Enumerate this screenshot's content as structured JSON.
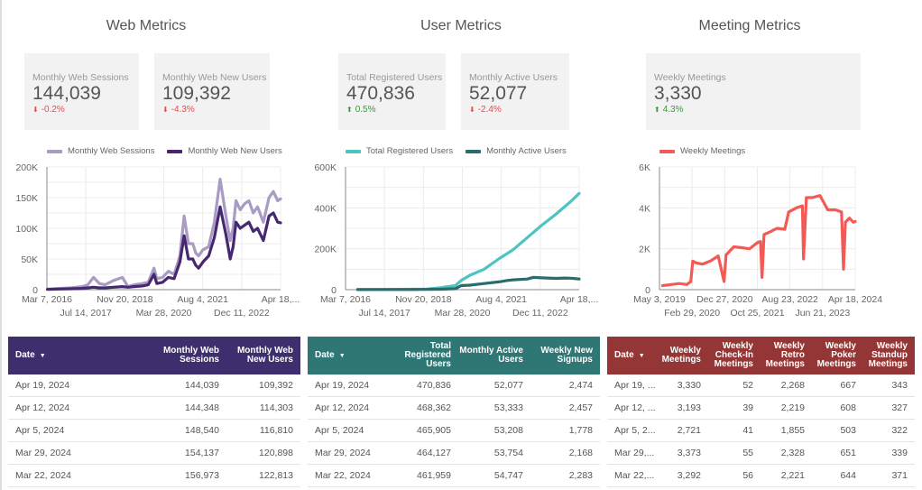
{
  "sections": {
    "web": {
      "title": "Web Metrics",
      "scorecards": [
        {
          "label": "Monthly Web Sessions",
          "value": "144,039",
          "delta": "-0.2%",
          "direction": "down"
        },
        {
          "label": "Monthly Web New Users",
          "value": "109,392",
          "delta": "-4.3%",
          "direction": "down"
        }
      ],
      "table": {
        "header_color": "#3f2e6e",
        "columns": [
          "Date",
          "Monthly Web Sessions",
          "Monthly Web New Users"
        ],
        "rows": [
          [
            "Apr 19, 2024",
            "144,039",
            "109,392"
          ],
          [
            "Apr 12, 2024",
            "144,348",
            "114,303"
          ],
          [
            "Apr 5, 2024",
            "148,540",
            "116,810"
          ],
          [
            "Mar 29, 2024",
            "154,137",
            "120,898"
          ],
          [
            "Mar 22, 2024",
            "156,973",
            "122,813"
          ]
        ]
      }
    },
    "user": {
      "title": "User Metrics",
      "scorecards": [
        {
          "label": "Total Registered Users",
          "value": "470,836",
          "delta": "0.5%",
          "direction": "up"
        },
        {
          "label": "Monthly Active Users",
          "value": "52,077",
          "delta": "-2.4%",
          "direction": "down"
        }
      ],
      "table": {
        "header_color": "#2e7775",
        "columns": [
          "Date",
          "Total Registered Users",
          "Monthly Active Users",
          "Weekly New Signups"
        ],
        "rows": [
          [
            "Apr 19, 2024",
            "470,836",
            "52,077",
            "2,474"
          ],
          [
            "Apr 12, 2024",
            "468,362",
            "53,333",
            "2,457"
          ],
          [
            "Apr 5, 2024",
            "465,905",
            "53,208",
            "1,778"
          ],
          [
            "Mar 29, 2024",
            "464,127",
            "53,754",
            "2,168"
          ],
          [
            "Mar 22, 2024",
            "461,959",
            "54,747",
            "2,283"
          ]
        ]
      }
    },
    "meeting": {
      "title": "Meeting Metrics",
      "scorecards": [
        {
          "label": "Weekly Meetings",
          "value": "3,330",
          "delta": "4.3%",
          "direction": "up"
        }
      ],
      "table": {
        "header_color": "#943635",
        "columns": [
          "Date",
          "Weekly Meetings",
          "Weekly Check-In Meetings",
          "Weekly Retro Meetings",
          "Weekly Poker Meetings",
          "Weekly Standup Meetings"
        ],
        "rows": [
          [
            "Apr 19, ...",
            "3,330",
            "52",
            "2,268",
            "667",
            "343"
          ],
          [
            "Apr 12, ...",
            "3,193",
            "39",
            "2,219",
            "608",
            "327"
          ],
          [
            "Apr 5, 2...",
            "2,721",
            "41",
            "1,855",
            "503",
            "322"
          ],
          [
            "Mar 29,...",
            "3,373",
            "55",
            "2,328",
            "651",
            "339"
          ],
          [
            "Mar 22,...",
            "3,292",
            "56",
            "2,221",
            "644",
            "371"
          ]
        ]
      }
    }
  },
  "icons": {
    "sort": "▼",
    "down": "⬇",
    "up": "⬆"
  },
  "colors": {
    "down": "#e84c4c",
    "up": "#3a9a3a"
  },
  "chart_data": [
    {
      "type": "line",
      "title": "",
      "legend": "top",
      "ylim": [
        0,
        200000
      ],
      "yticks": [
        "0",
        "50K",
        "100K",
        "150K",
        "200K"
      ],
      "xticks_row1": [
        "Mar 7, 2016",
        "Nov 20, 2018",
        "Aug 4, 2021",
        "Apr 18,..."
      ],
      "xticks_row2": [
        "Jul 14, 2017",
        "Mar 28, 2020",
        "Dec 11, 2022"
      ],
      "x_range": [
        2016.18,
        2024.3
      ],
      "series": [
        {
          "name": "Monthly Web Sessions",
          "color": "#a99bc4",
          "x": [
            2016.2,
            2016.6,
            2017.0,
            2017.4,
            2017.6,
            2017.8,
            2018.0,
            2018.2,
            2018.5,
            2018.8,
            2019.0,
            2019.2,
            2019.5,
            2019.7,
            2019.9,
            2020.0,
            2020.2,
            2020.4,
            2020.6,
            2020.8,
            2020.95,
            2021.1,
            2021.25,
            2021.35,
            2021.45,
            2021.6,
            2021.8,
            2022.0,
            2022.2,
            2022.4,
            2022.55,
            2022.65,
            2022.75,
            2022.9,
            2023.05,
            2023.2,
            2023.35,
            2023.5,
            2023.7,
            2023.9,
            2024.05,
            2024.2,
            2024.3
          ],
          "y": [
            1000,
            2000,
            3000,
            5000,
            8000,
            20000,
            10000,
            8000,
            15000,
            20000,
            5000,
            8000,
            10000,
            12000,
            35000,
            18000,
            20000,
            30000,
            25000,
            55000,
            120000,
            75000,
            75000,
            60000,
            55000,
            65000,
            70000,
            110000,
            180000,
            120000,
            80000,
            100000,
            145000,
            130000,
            140000,
            145000,
            125000,
            135000,
            110000,
            150000,
            160000,
            145000,
            148000
          ]
        },
        {
          "name": "Monthly Web New Users",
          "color": "#45286f",
          "x": [
            2016.2,
            2016.6,
            2017.0,
            2017.4,
            2017.6,
            2017.8,
            2018.0,
            2018.2,
            2018.5,
            2018.8,
            2019.0,
            2019.2,
            2019.5,
            2019.7,
            2019.9,
            2020.0,
            2020.2,
            2020.4,
            2020.6,
            2020.8,
            2020.95,
            2021.1,
            2021.25,
            2021.35,
            2021.45,
            2021.6,
            2021.8,
            2022.0,
            2022.2,
            2022.4,
            2022.55,
            2022.65,
            2022.75,
            2022.9,
            2023.05,
            2023.2,
            2023.35,
            2023.5,
            2023.7,
            2023.9,
            2024.05,
            2024.2,
            2024.3
          ],
          "y": [
            500,
            1000,
            1500,
            2000,
            3000,
            4000,
            3000,
            3000,
            4000,
            5000,
            4000,
            5000,
            6000,
            8000,
            25000,
            10000,
            12000,
            20000,
            18000,
            45000,
            88000,
            50000,
            50000,
            40000,
            35000,
            45000,
            55000,
            85000,
            135000,
            90000,
            50000,
            70000,
            110000,
            100000,
            105000,
            110000,
            95000,
            100000,
            80000,
            120000,
            125000,
            110000,
            109000
          ]
        }
      ]
    },
    {
      "type": "line",
      "title": "",
      "legend": "top",
      "ylim": [
        0,
        600000
      ],
      "yticks": [
        "0",
        "200K",
        "400K",
        "600K"
      ],
      "xticks_row1": [
        "Mar 7, 2016",
        "Nov 20, 2018",
        "Aug 4, 2021",
        "Apr 18,..."
      ],
      "xticks_row2": [
        "Jul 14, 2017",
        "Mar 28, 2020",
        "Dec 11, 2022"
      ],
      "x_range": [
        2016.18,
        2024.3
      ],
      "series": [
        {
          "name": "Total Registered Users",
          "color": "#4dc4c2",
          "x": [
            2016.6,
            2017.5,
            2018.5,
            2019.0,
            2019.5,
            2020.0,
            2020.2,
            2020.5,
            2021.0,
            2021.5,
            2022.0,
            2022.5,
            2023.0,
            2023.5,
            2024.0,
            2024.3
          ],
          "y": [
            500,
            1000,
            2000,
            3000,
            10000,
            20000,
            45000,
            70000,
            100000,
            150000,
            195000,
            255000,
            315000,
            370000,
            430000,
            470836
          ]
        },
        {
          "name": "Monthly Active Users",
          "color": "#2a6b6b",
          "x": [
            2016.6,
            2017.5,
            2018.5,
            2019.5,
            2020.0,
            2020.2,
            2020.5,
            2021.0,
            2021.5,
            2021.8,
            2022.0,
            2022.5,
            2022.7,
            2023.0,
            2023.5,
            2023.8,
            2024.0,
            2024.3
          ],
          "y": [
            500,
            800,
            1000,
            2000,
            5000,
            20000,
            22000,
            30000,
            38000,
            45000,
            48000,
            52000,
            60000,
            58000,
            55000,
            57000,
            56000,
            52077
          ]
        }
      ]
    },
    {
      "type": "line",
      "title": "",
      "legend": "top",
      "ylim": [
        0,
        6000
      ],
      "yticks": [
        "0",
        "2K",
        "4K",
        "6K"
      ],
      "xticks_row1": [
        "May 3, 2019",
        "Dec 27, 2020",
        "Aug 23, 2022",
        "Apr 18, 2024"
      ],
      "xticks_row2": [
        "Feb 29, 2020",
        "Oct 25, 2021",
        "Jun 21, 2023"
      ],
      "x_range": [
        2019.3,
        2024.3
      ],
      "series": [
        {
          "name": "Weekly Meetings",
          "color": "#f35a55",
          "x": [
            2019.38,
            2019.6,
            2019.8,
            2020.0,
            2020.1,
            2020.15,
            2020.25,
            2020.4,
            2020.6,
            2020.8,
            2020.95,
            2021.0,
            2021.05,
            2021.2,
            2021.4,
            2021.6,
            2021.8,
            2021.88,
            2021.92,
            2021.97,
            2022.1,
            2022.3,
            2022.5,
            2022.6,
            2022.8,
            2022.95,
            2022.98,
            2023.05,
            2023.2,
            2023.4,
            2023.6,
            2023.8,
            2023.95,
            2024.0,
            2024.05,
            2024.15,
            2024.25,
            2024.3
          ],
          "y": [
            200,
            250,
            300,
            250,
            400,
            1400,
            1300,
            1250,
            1400,
            1650,
            400,
            1700,
            1800,
            2100,
            2050,
            2000,
            2300,
            2350,
            600,
            2700,
            2800,
            3000,
            2950,
            3800,
            4000,
            4100,
            1500,
            4500,
            4500,
            4600,
            3900,
            3900,
            3800,
            1000,
            3300,
            3500,
            3300,
            3330
          ]
        }
      ]
    }
  ]
}
